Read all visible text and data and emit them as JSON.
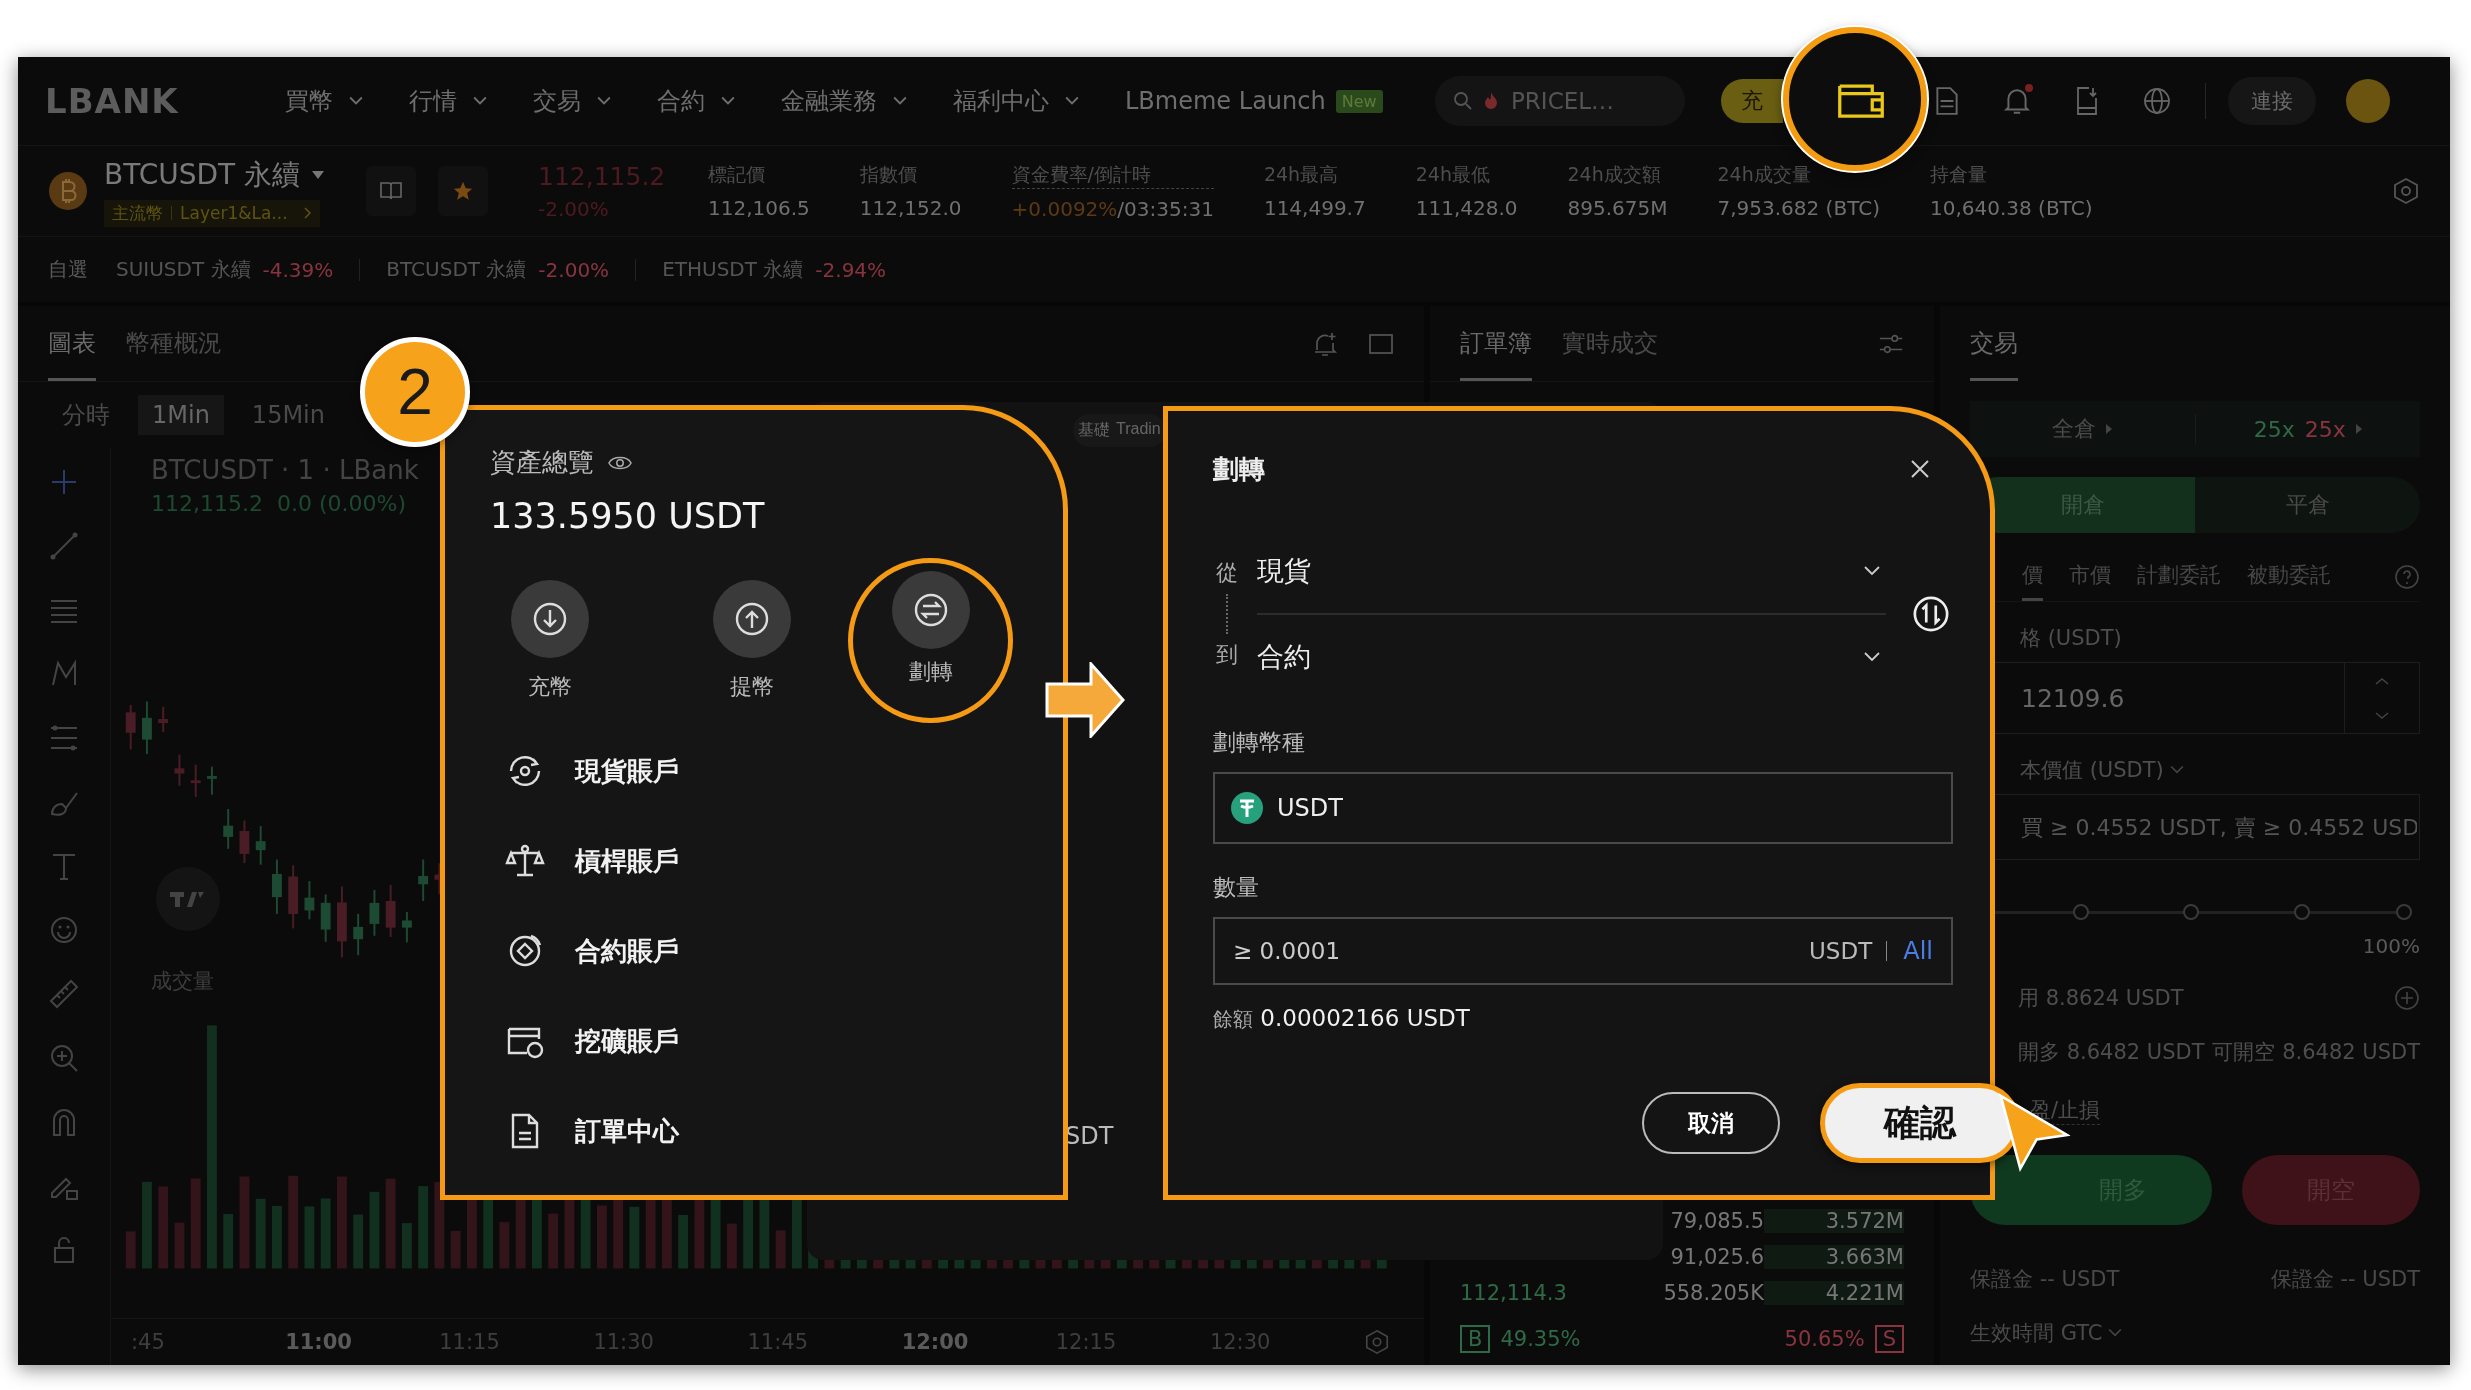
{
  "nav": {
    "logo": "LBANK",
    "menu": [
      {
        "label": "買幣"
      },
      {
        "label": "行情"
      },
      {
        "label": "交易"
      },
      {
        "label": "合約"
      },
      {
        "label": "金融業務"
      },
      {
        "label": "福利中心"
      }
    ],
    "launch": {
      "label": "LBmeme Launch",
      "badge": "New"
    },
    "search": {
      "placeholder": "PRICEL…"
    },
    "deposit_button": "充",
    "wallet_highlighted": true,
    "notification_dot": true,
    "connect_button": "連接"
  },
  "ticker": {
    "symbol": "BTCUSDT 永續",
    "tags": [
      "主流幣",
      "Layer1&La..."
    ],
    "favorite": true,
    "price": "112,115.2",
    "change": "-2.00%",
    "stats": [
      {
        "label": "標記價",
        "value": "112,106.5"
      },
      {
        "label": "指數價",
        "value": "112,152.0"
      },
      {
        "label": "資金費率/倒計時",
        "rate": "+0.0092%",
        "value": "/03:35:31"
      },
      {
        "label": "24h最高",
        "value": "114,499.7"
      },
      {
        "label": "24h最低",
        "value": "111,428.0"
      },
      {
        "label": "24h成交額",
        "value": "895.675M"
      },
      {
        "label": "24h成交量",
        "value": "7,953.682 (BTC)"
      },
      {
        "label": "持倉量",
        "value": "10,640.38 (BTC)"
      }
    ]
  },
  "favorites": {
    "label": "自選",
    "items": [
      {
        "symbol": "SUIUSDT 永續",
        "change": "-4.39%"
      },
      {
        "symbol": "BTCUSDT 永續",
        "change": "-2.00%"
      },
      {
        "symbol": "ETHUSDT 永續",
        "change": "-2.94%"
      }
    ]
  },
  "chart_panel": {
    "tabs": [
      {
        "label": "圖表",
        "selected": true
      },
      {
        "label": "幣種概況",
        "selected": false
      }
    ],
    "intervals": [
      {
        "label": "分時",
        "selected": false
      },
      {
        "label": "1Min",
        "selected": true
      },
      {
        "label": "15Min",
        "selected": false
      }
    ],
    "legend_title": "BTCUSDT · 1 · LBank",
    "legend_price": "112,115.2",
    "legend_change": "0.0 (0.00%)",
    "volume_label": "成交量",
    "time_axis": [
      ":45",
      "11:00",
      "11:15",
      "11:30",
      "11:45",
      "12:00",
      "12:15",
      "12:30"
    ]
  },
  "covered_order_form": {
    "tabs": [
      "基礎",
      "Tradin"
    ],
    "unit": "SDT"
  },
  "order_book": {
    "tabs": [
      {
        "label": "訂單簿",
        "selected": true
      },
      {
        "label": "實時成交",
        "selected": false
      }
    ],
    "rows": [
      {
        "amount": "79,085.5",
        "total": "3.572M"
      },
      {
        "amount": "91,025.6",
        "total": "3.663M"
      },
      {
        "price": "112,114.3",
        "amount": "558.205K",
        "total": "4.221M"
      }
    ],
    "ratio": {
      "buy_label": "B",
      "buy": "49.35%",
      "sell": "50.65%",
      "sell_label": "S"
    }
  },
  "trade_panel": {
    "title": "交易",
    "margin_mode": "全倉",
    "leverage_long": "25x",
    "leverage_short": "25x",
    "position_tabs": [
      {
        "label": "開倉",
        "selected": true
      },
      {
        "label": "平倉",
        "selected": false
      }
    ],
    "order_types": [
      {
        "label": "價",
        "selected": true
      },
      {
        "label": "市價",
        "selected": false
      },
      {
        "label": "計劃委託",
        "selected": false
      },
      {
        "label": "被動委託",
        "selected": false
      }
    ],
    "price_label": "格 (USDT)",
    "price_value": "12109.6",
    "cost_label": "本價值 (USDT)",
    "cost_placeholder": "買 ≥ 0.4552 USDT, 賣 ≥ 0.4552 USD",
    "slider": {
      "level": 0,
      "max_label": "100%"
    },
    "available": "用 8.8624 USDT",
    "can_long": "開多 8.6482 USDT",
    "can_short": "可開空 8.6482 USDT",
    "tpsl": "盈/止損",
    "long_button": "開多",
    "short_button": "開空",
    "margins": [
      "保證金 -- USDT",
      "保證金 -- USDT"
    ],
    "time_in_force": "生效時間 GTC"
  },
  "step_badge": "2",
  "asset_popup": {
    "title": "資產總覽",
    "balance": "133.5950 USDT",
    "actions": [
      {
        "kind": "deposit",
        "label": "充幣",
        "highlighted": false
      },
      {
        "kind": "withdraw",
        "label": "提幣",
        "highlighted": false
      },
      {
        "kind": "transfer",
        "label": "劃轉",
        "highlighted": true
      }
    ],
    "accounts": [
      {
        "kind": "spot",
        "label": "現貨賬戶"
      },
      {
        "kind": "margin",
        "label": "槓桿賬戶"
      },
      {
        "kind": "futures",
        "label": "合約賬戶"
      },
      {
        "kind": "mining",
        "label": "挖礦賬戶"
      },
      {
        "kind": "orders",
        "label": "訂單中心"
      }
    ]
  },
  "transfer_dialog": {
    "title": "劃轉",
    "from_label": "從",
    "from": "現貨",
    "to_label": "到",
    "to": "合約",
    "coin_label": "劃轉幣種",
    "coin": "USDT",
    "amount_label": "數量",
    "amount_placeholder": "≥ 0.0001",
    "amount_unit": "USDT",
    "all_button": "All",
    "balance_label": "餘額",
    "balance": "0.00002166 USDT",
    "cancel_button": "取消",
    "confirm_button": "確認",
    "confirm_highlighted": true
  }
}
